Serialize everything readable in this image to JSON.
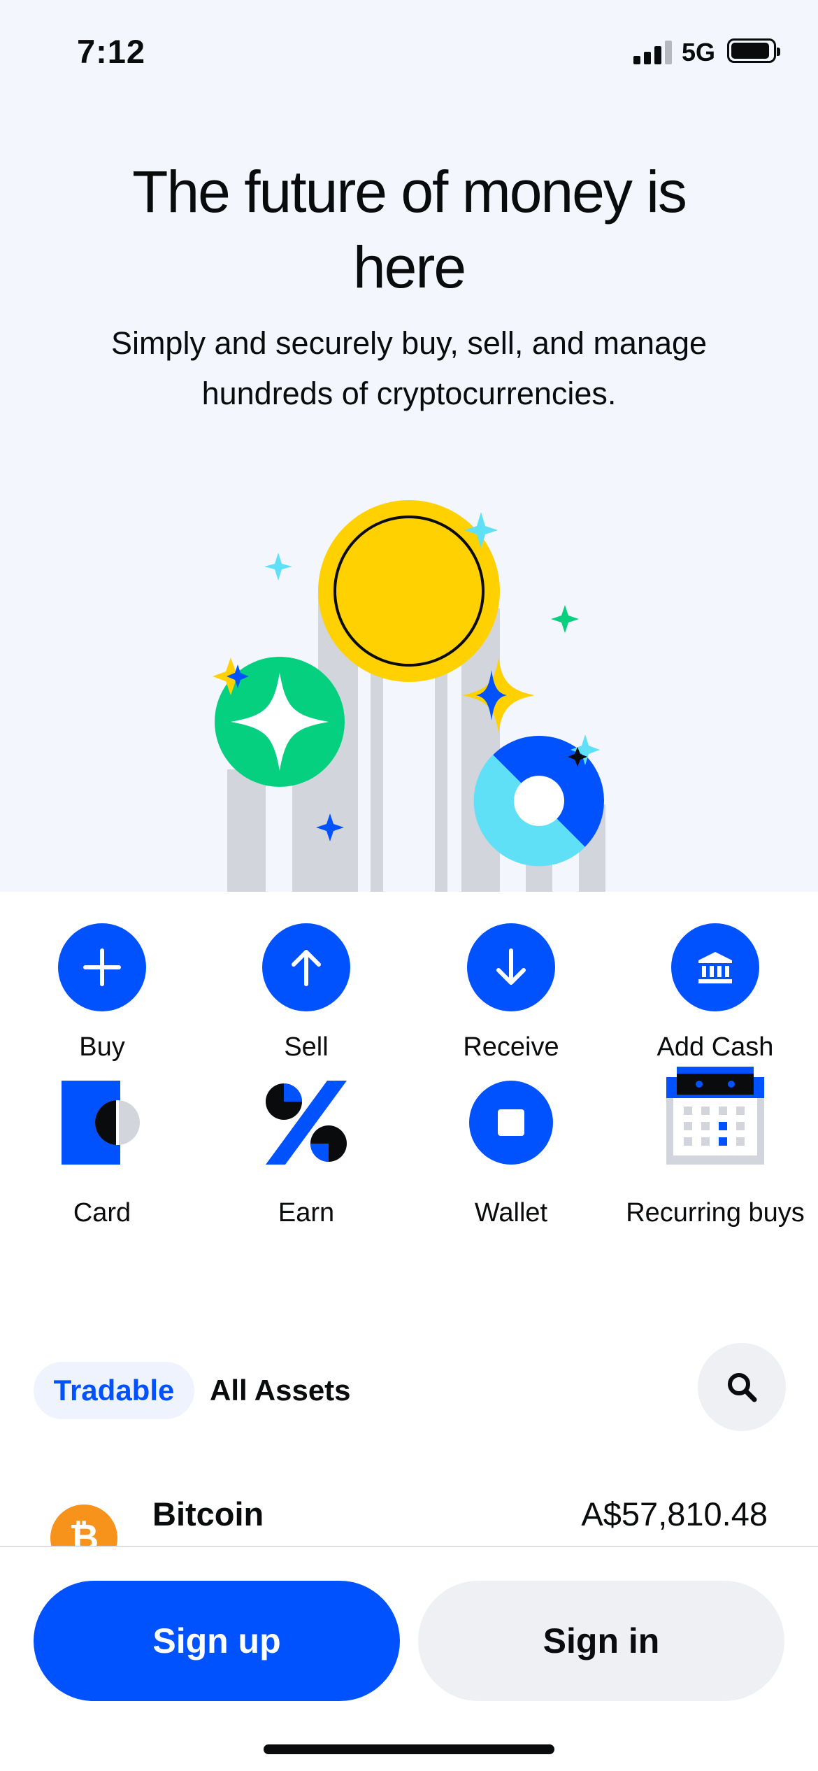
{
  "status_bar": {
    "time": "7:12",
    "network": "5G",
    "signal_bars": 3,
    "signal_bars_total": 4,
    "battery_level": 0.85
  },
  "hero": {
    "title": "The future of money is here",
    "subtitle": "Simply and securely buy, sell, and manage hundreds of cryptocurrencies."
  },
  "quick_actions": [
    {
      "label": "Buy",
      "icon": "plus-icon"
    },
    {
      "label": "Sell",
      "icon": "arrow-up-icon"
    },
    {
      "label": "Receive",
      "icon": "arrow-down-icon"
    },
    {
      "label": "Add Cash",
      "icon": "bank-icon"
    }
  ],
  "features": [
    {
      "label": "Card",
      "icon": "card-icon"
    },
    {
      "label": "Earn",
      "icon": "percent-icon"
    },
    {
      "label": "Wallet",
      "icon": "wallet-icon"
    },
    {
      "label": "Recurring buys",
      "icon": "calendar-icon"
    }
  ],
  "asset_tabs": {
    "tradable": "Tradable",
    "all_assets": "All Assets",
    "active": "Tradable"
  },
  "assets": [
    {
      "name": "Bitcoin",
      "symbol": "₿",
      "price": "A$57,810.48"
    }
  ],
  "auth": {
    "sign_up": "Sign up",
    "sign_in": "Sign in"
  },
  "colors": {
    "brand_blue": "#0052ff",
    "hero_background": "#f3f6fd",
    "coin_yellow": "#ffd100",
    "green": "#05d07f",
    "cyan": "#5fe0f7",
    "bitcoin_orange": "#f7931a"
  }
}
